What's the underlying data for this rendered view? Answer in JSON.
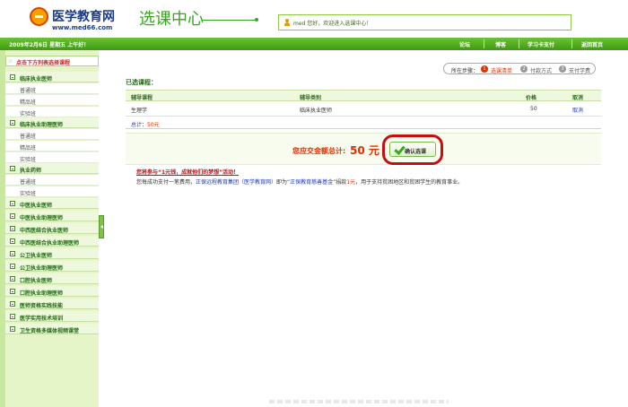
{
  "header": {
    "logo_title": "医学教育网",
    "logo_url": "www.med66.com",
    "section_title": "选课中心",
    "welcome": "med 您好，欢迎进入选课中心！"
  },
  "nav": {
    "date": "2009年2月6日  星期五    上午好！",
    "items": [
      "论坛",
      "博客",
      "学习卡支付",
      "返回首页"
    ]
  },
  "sidebar": {
    "header": "点击下方列表选择课程",
    "categories": [
      {
        "label": "临床执业医师",
        "subs": [
          "普通班",
          "精品班",
          "实验班"
        ]
      },
      {
        "label": "临床执业助理医师",
        "subs": [
          "普通班",
          "精品班",
          "实验班"
        ]
      },
      {
        "label": "执业药师",
        "subs": [
          "普通班",
          "实验班"
        ]
      },
      {
        "label": "中医执业医师",
        "subs": []
      },
      {
        "label": "中医执业助理医师",
        "subs": []
      },
      {
        "label": "中西医结合执业医师",
        "subs": []
      },
      {
        "label": "中西医结合执业助理医师",
        "subs": []
      },
      {
        "label": "公卫执业医师",
        "subs": []
      },
      {
        "label": "公卫执业助理医师",
        "subs": []
      },
      {
        "label": "口腔执业医师",
        "subs": []
      },
      {
        "label": "口腔执业助理医师",
        "subs": []
      },
      {
        "label": "医师资格实践技能",
        "subs": []
      },
      {
        "label": "医学实用技术培训",
        "subs": []
      },
      {
        "label": "卫生资格多媒体视频课堂",
        "subs": []
      }
    ]
  },
  "steps": {
    "label": "所在步骤：",
    "items": [
      {
        "num": "1",
        "text": "选课清单",
        "active": true
      },
      {
        "num": "2",
        "text": "付款方式",
        "active": false
      },
      {
        "num": "3",
        "text": "支付学费",
        "active": false
      }
    ]
  },
  "main": {
    "selected_title": "已选课程：",
    "columns": [
      "辅导课程",
      "辅导类别",
      "价格",
      "取消"
    ],
    "rows": [
      {
        "course": "生理学",
        "category": "临床执业医师",
        "price": "50",
        "action": "取消"
      }
    ],
    "total_label": "总计：",
    "total_amount": "50元",
    "pay_label": "您应交金额总计:",
    "pay_amount": "50 元",
    "confirm_button": "确认选课",
    "promo_title": "您将参与“1元钱，成就他们的梦想”活动！",
    "promo_text_1": "您每成功支付一笔费用，",
    "promo_link_1": "正保远程教育集团（医学教育网）",
    "promo_text_2": "即为“",
    "promo_link_2": "正保教育慈善基金",
    "promo_text_3": "”捐款",
    "promo_amount": "1元",
    "promo_text_4": "，用于支持贫困地区和贫困学生的教育事业。"
  },
  "colors": {
    "brand_green": "#3aa520",
    "accent_red": "#c41010",
    "link_blue": "#1a3ab8"
  }
}
